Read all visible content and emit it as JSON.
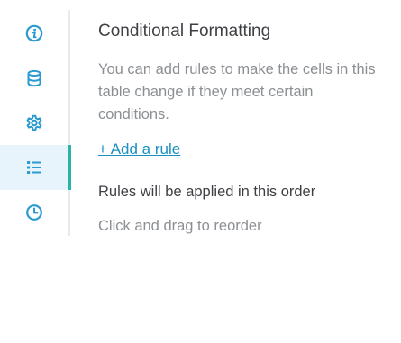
{
  "sidebar": {
    "items": [
      {
        "icon": "info-icon",
        "active": false
      },
      {
        "icon": "database-icon",
        "active": false
      },
      {
        "icon": "gear-icon",
        "active": false
      },
      {
        "icon": "list-icon",
        "active": true
      },
      {
        "icon": "clock-icon",
        "active": false
      }
    ],
    "icon_color": "#2a9bd0",
    "active_bg": "#e7f4fb",
    "active_accent": "#2cb3a5"
  },
  "panel": {
    "title": "Conditional Formatting",
    "description": "You can add rules to make the cells in this table change if they meet certain conditions.",
    "add_rule_label": "+ Add a rule",
    "order_heading": "Rules will be applied in this order",
    "drag_hint": "Click and drag to reorder"
  }
}
